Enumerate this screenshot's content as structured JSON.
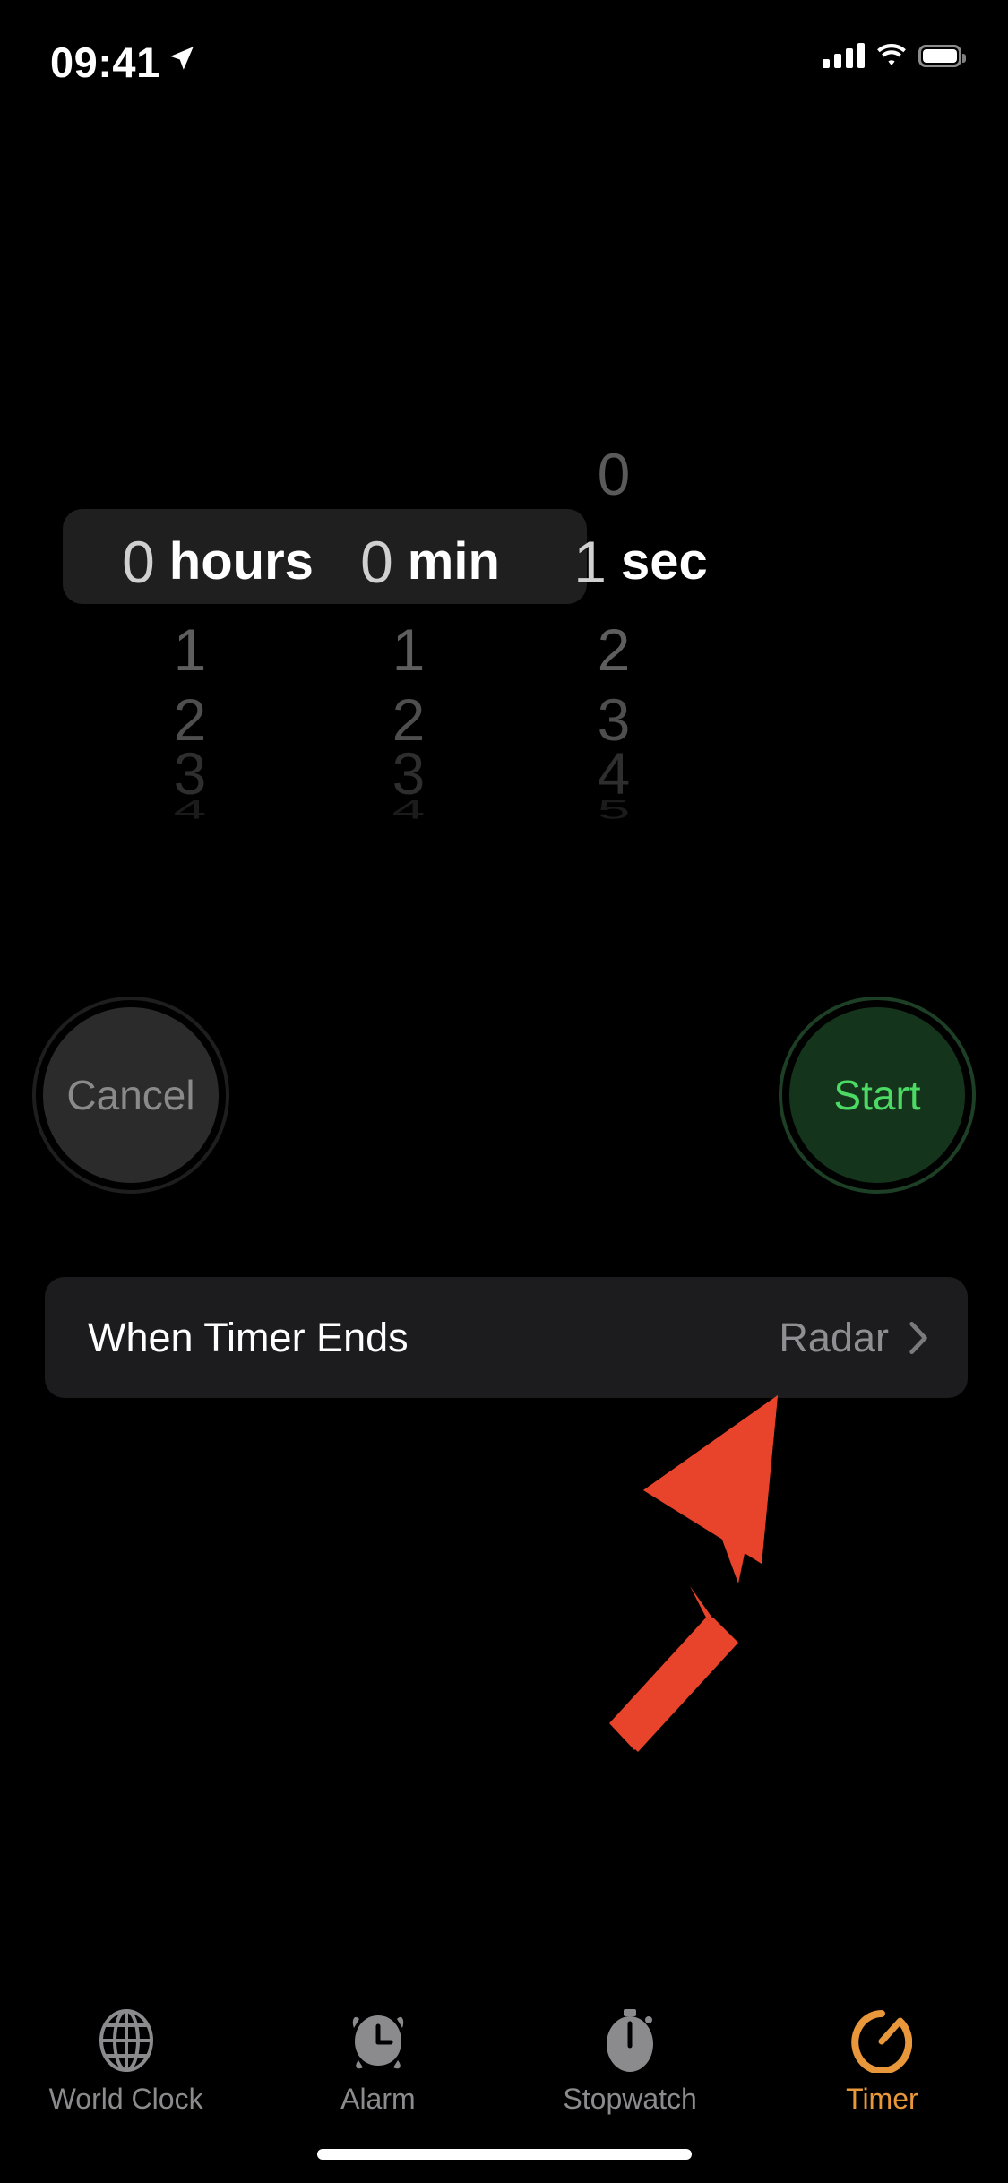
{
  "status_bar": {
    "time": "09:41",
    "location_icon": "location-arrow-icon",
    "cellular_icon": "cellular-bars-icon",
    "wifi_icon": "wifi-icon",
    "battery_icon": "battery-full-icon"
  },
  "picker": {
    "columns": [
      {
        "name": "hours",
        "unit": "hours",
        "selected_value": "0",
        "rows_above": [],
        "rows_below": [
          "1",
          "2",
          "3",
          "4"
        ]
      },
      {
        "name": "minutes",
        "unit": "min",
        "selected_value": "0",
        "rows_above": [],
        "rows_below": [
          "1",
          "2",
          "3",
          "4"
        ]
      },
      {
        "name": "seconds",
        "unit": "sec",
        "selected_value": "1",
        "rows_above": [
          "0"
        ],
        "rows_below": [
          "2",
          "3",
          "4",
          "5"
        ]
      }
    ]
  },
  "actions": {
    "cancel_label": "Cancel",
    "start_label": "Start",
    "start_color": "#4cd964",
    "start_bg": "#15341c",
    "cancel_color": "#8a8a8a",
    "cancel_bg": "#2b2b2b"
  },
  "when_timer_ends": {
    "title": "When Timer Ends",
    "value": "Radar",
    "chevron_icon": "chevron-right-icon"
  },
  "annotation": {
    "arrow_icon": "arrow-up-right-icon",
    "color": "#e8432b"
  },
  "tab_bar": {
    "items": [
      {
        "label": "World Clock",
        "icon": "globe-icon",
        "active": false
      },
      {
        "label": "Alarm",
        "icon": "alarm-clock-icon",
        "active": false
      },
      {
        "label": "Stopwatch",
        "icon": "stopwatch-icon",
        "active": false
      },
      {
        "label": "Timer",
        "icon": "timer-icon",
        "active": true
      }
    ],
    "active_color": "#e8973a",
    "inactive_color": "#8b8b8e"
  },
  "home_indicator": "home-indicator"
}
